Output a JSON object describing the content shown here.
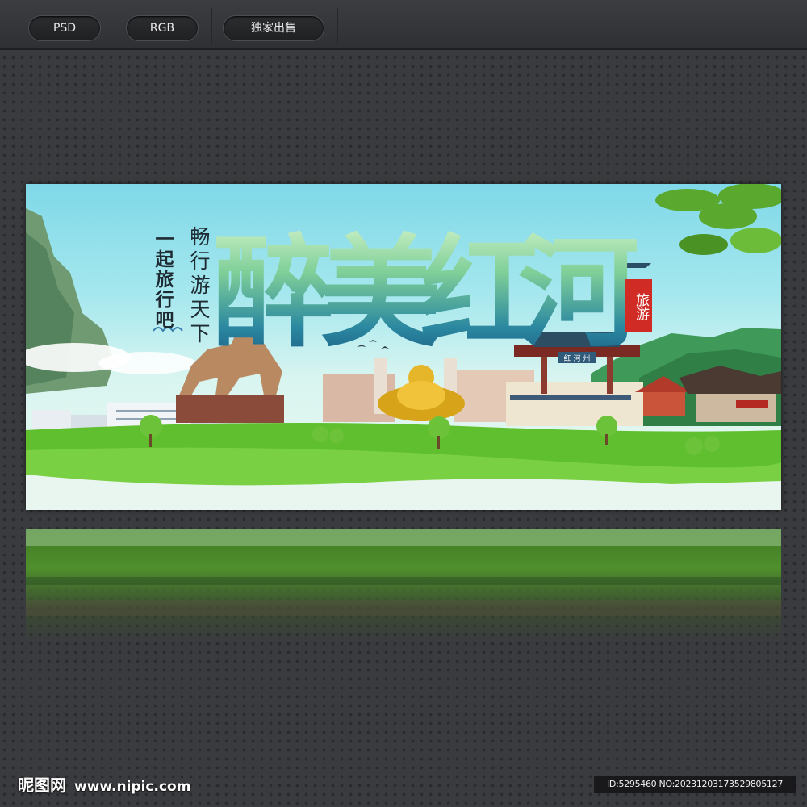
{
  "toolbar": {
    "buttons": [
      {
        "label": "PSD"
      },
      {
        "label": "RGB"
      },
      {
        "label": "独家出售"
      }
    ]
  },
  "banner": {
    "title_chars": [
      "醉",
      "美",
      "红",
      "河"
    ],
    "slogan_left": "一起旅行吧",
    "slogan_right": "畅行游天下",
    "stamp": "旅游",
    "gate_plaque": "红 河 州"
  },
  "footer": {
    "logo": "昵图网",
    "url": "www.nipic.com",
    "id_text": "ID:5295460 NO:20231203173529805127"
  },
  "colors": {
    "background": "#3a3b3e",
    "stamp_red": "#d02b25",
    "grass": "#5fbf2e",
    "sky": "#7fd8e8"
  }
}
